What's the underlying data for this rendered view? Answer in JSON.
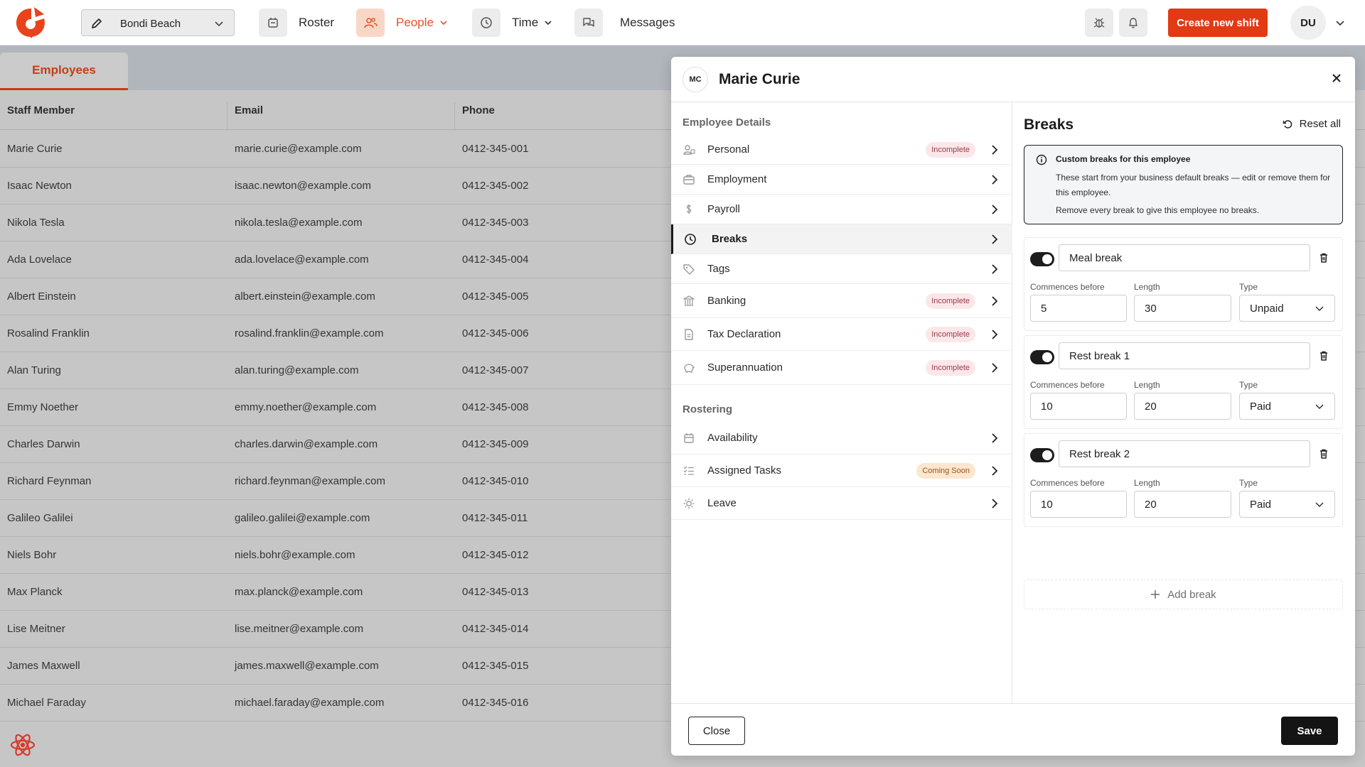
{
  "header": {
    "location": "Bondi Beach",
    "nav": [
      {
        "label": "Roster",
        "icon": "calendar-icon"
      },
      {
        "label": "People",
        "icon": "people-icon",
        "active": true
      },
      {
        "label": "Time",
        "icon": "clock-icon"
      },
      {
        "label": "Messages",
        "icon": "chat-icon"
      }
    ],
    "create_shift_label": "Create new shift",
    "user_initials": "DU"
  },
  "employees_page": {
    "tab_label": "Employees",
    "columns": [
      "Staff Member",
      "Email",
      "Phone"
    ],
    "rows": [
      {
        "name": "Marie Curie",
        "email": "marie.curie@example.com",
        "phone": "0412-345-001"
      },
      {
        "name": "Isaac Newton",
        "email": "isaac.newton@example.com",
        "phone": "0412-345-002"
      },
      {
        "name": "Nikola Tesla",
        "email": "nikola.tesla@example.com",
        "phone": "0412-345-003"
      },
      {
        "name": "Ada Lovelace",
        "email": "ada.lovelace@example.com",
        "phone": "0412-345-004"
      },
      {
        "name": "Albert Einstein",
        "email": "albert.einstein@example.com",
        "phone": "0412-345-005"
      },
      {
        "name": "Rosalind Franklin",
        "email": "rosalind.franklin@example.com",
        "phone": "0412-345-006"
      },
      {
        "name": "Alan Turing",
        "email": "alan.turing@example.com",
        "phone": "0412-345-007"
      },
      {
        "name": "Emmy Noether",
        "email": "emmy.noether@example.com",
        "phone": "0412-345-008"
      },
      {
        "name": "Charles Darwin",
        "email": "charles.darwin@example.com",
        "phone": "0412-345-009"
      },
      {
        "name": "Richard Feynman",
        "email": "richard.feynman@example.com",
        "phone": "0412-345-010"
      },
      {
        "name": "Galileo Galilei",
        "email": "galileo.galilei@example.com",
        "phone": "0412-345-011"
      },
      {
        "name": "Niels Bohr",
        "email": "niels.bohr@example.com",
        "phone": "0412-345-012"
      },
      {
        "name": "Max Planck",
        "email": "max.planck@example.com",
        "phone": "0412-345-013"
      },
      {
        "name": "Lise Meitner",
        "email": "lise.meitner@example.com",
        "phone": "0412-345-014"
      },
      {
        "name": "James Maxwell",
        "email": "james.maxwell@example.com",
        "phone": "0412-345-015"
      },
      {
        "name": "Michael Faraday",
        "email": "michael.faraday@example.com",
        "phone": "0412-345-016"
      }
    ]
  },
  "modal": {
    "initials": "MC",
    "title": "Marie Curie",
    "employee_details_title": "Employee Details",
    "employee_details": [
      {
        "label": "Personal",
        "icon": "person-icon",
        "badge": "Incomplete"
      },
      {
        "label": "Employment",
        "icon": "briefcase-icon"
      },
      {
        "label": "Payroll",
        "icon": "dollar-icon"
      },
      {
        "label": "Breaks",
        "icon": "clock-icon",
        "active": true
      },
      {
        "label": "Tags",
        "icon": "tag-icon"
      },
      {
        "label": "Banking",
        "icon": "bank-icon",
        "badge": "Incomplete"
      },
      {
        "label": "Tax Declaration",
        "icon": "document-icon",
        "badge": "Incomplete"
      },
      {
        "label": "Superannuation",
        "icon": "piggy-bank-icon",
        "badge": "Incomplete"
      }
    ],
    "rostering_title": "Rostering",
    "rostering": [
      {
        "label": "Availability",
        "icon": "calendar-icon"
      },
      {
        "label": "Assigned Tasks",
        "icon": "checklist-icon",
        "badge": "Coming Soon"
      },
      {
        "label": "Leave",
        "icon": "sun-icon"
      }
    ],
    "breaks_panel": {
      "title": "Breaks",
      "reset_all_label": "Reset all",
      "info_title": "Custom breaks for this employee",
      "info_text": "These start from your business default breaks — edit or remove them for this employee.",
      "info_text_2": "Remove every break to give this employee no breaks.",
      "field_labels": {
        "commences_before": "Commences before",
        "length": "Length",
        "type": "Type"
      },
      "breaks": [
        {
          "name": "Meal break",
          "enabled": true,
          "commences_before": "5",
          "length": "30",
          "type": "Unpaid"
        },
        {
          "name": "Rest break 1",
          "enabled": true,
          "commences_before": "10",
          "length": "20",
          "type": "Paid"
        },
        {
          "name": "Rest break 2",
          "enabled": true,
          "commences_before": "10",
          "length": "20",
          "type": "Paid"
        }
      ],
      "add_break_label": "Add break"
    },
    "footer": {
      "close_label": "Close",
      "save_label": "Save"
    }
  }
}
